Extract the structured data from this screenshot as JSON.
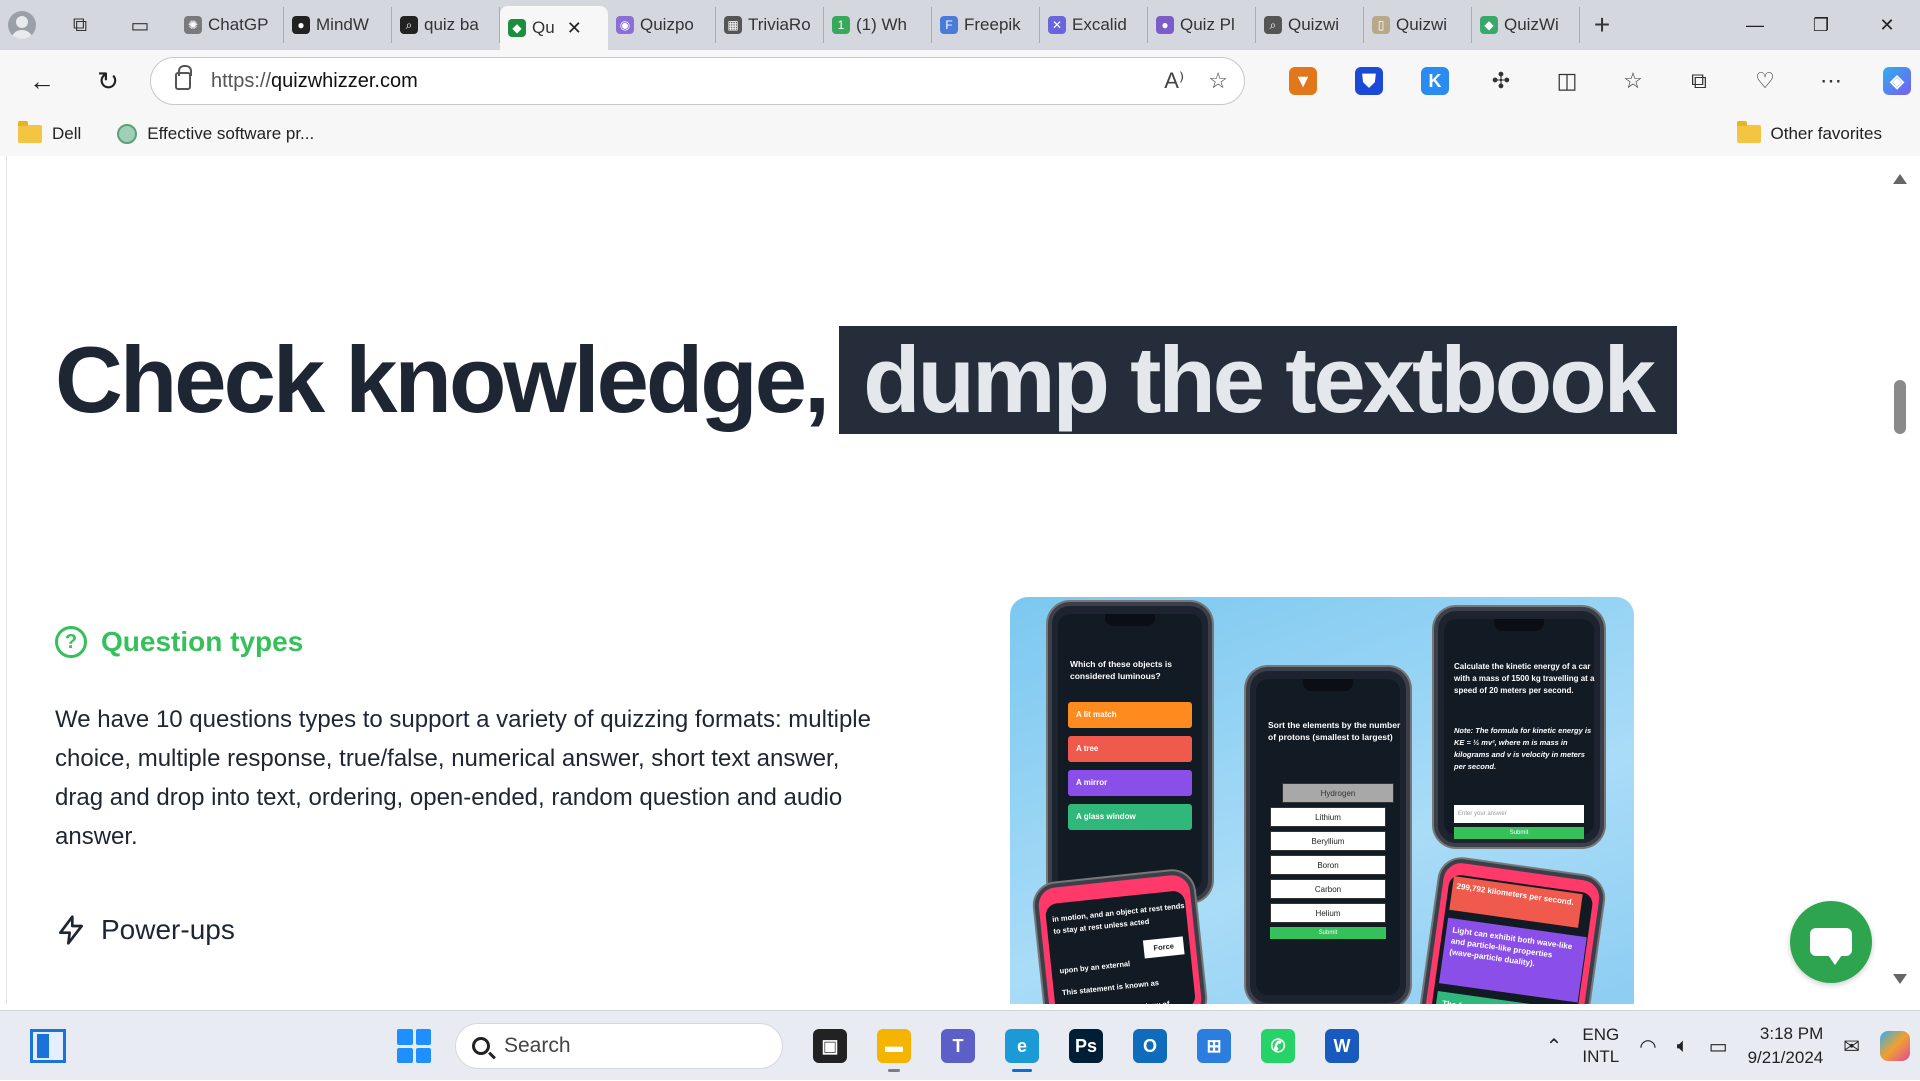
{
  "browser": {
    "tabs": [
      {
        "label": "ChatGP",
        "color": "#7a7a7a",
        "glyph": "✺"
      },
      {
        "label": "MindW",
        "color": "#222222",
        "glyph": "●"
      },
      {
        "label": "quiz ba",
        "color": "#222222",
        "glyph": "⌕"
      },
      {
        "label": "Qu",
        "color": "#1b8f3e",
        "glyph": "◆",
        "active": true
      },
      {
        "label": "Quizpo",
        "color": "#8b6fd6",
        "glyph": "◉"
      },
      {
        "label": "TriviaRo",
        "color": "#555555",
        "glyph": "▦"
      },
      {
        "label": "(1) Wh",
        "color": "#3aa85a",
        "glyph": "1"
      },
      {
        "label": "Freepik",
        "color": "#4a7bd8",
        "glyph": "F"
      },
      {
        "label": "Excalid",
        "color": "#6965db",
        "glyph": "✕"
      },
      {
        "label": "Quiz Pl",
        "color": "#7b5cc9",
        "glyph": "●"
      },
      {
        "label": "Quizwi",
        "color": "#555555",
        "glyph": "⌕"
      },
      {
        "label": "Quizwi",
        "color": "#b8a88a",
        "glyph": "▯"
      },
      {
        "label": "QuizWi",
        "color": "#39a86b",
        "glyph": "◆"
      }
    ],
    "url_prefix": "https://",
    "url_domain": "quizwhizzer.com",
    "read_aloud_icon": "A⁾",
    "favorites": [
      {
        "label": "Dell",
        "icon": "folder-icon"
      },
      {
        "label": "Effective software pr...",
        "icon": "chatgpt-icon"
      }
    ],
    "other_favorites": "Other favorites",
    "extensions": [
      {
        "name": "metamask-icon",
        "color": "#e2761b",
        "glyph": "🦊"
      },
      {
        "name": "shield-icon",
        "color": "#1a4ad6",
        "glyph": "⛊"
      },
      {
        "name": "k-extension-icon",
        "color": "#2a8cf0",
        "glyph": "K"
      }
    ]
  },
  "page": {
    "hero_plain": "Check knowledge,",
    "hero_highlight": "dump the textbook",
    "feature_title": "Question types",
    "feature_desc": "We have 10 questions types to support a variety of quizzing formats: multiple choice, multiple response, true/false, numerical answer, short text answer, drag and drop into text, ordering, open-ended, random question and audio answer.",
    "power_title": "Power-ups",
    "accent_color": "#35c05a"
  },
  "phones": {
    "p1_question": "Which of these objects is considered luminous?",
    "p1_options": [
      {
        "text": "A lit match",
        "color": "#ff8a1d"
      },
      {
        "text": "A tree",
        "color": "#ef5a4c"
      },
      {
        "text": "A mirror",
        "color": "#8a4fe8"
      },
      {
        "text": "A glass window",
        "color": "#2fb87a"
      }
    ],
    "p2_question": "Sort the elements by the number of protons (smallest to largest)",
    "p2_items": [
      "Hydrogen",
      "Lithium",
      "Beryllium",
      "Boron",
      "Carbon",
      "Helium"
    ],
    "p2_submit": "Submit",
    "p3_question": "Calculate the kinetic energy of a car with a mass of 1500 kg travelling at a speed of 20 meters per second.",
    "p3_note": "Note: The formula for kinetic energy is KE = ½ mv², where m is mass in kilograms and v is velocity in meters per second.",
    "p3_placeholder": "Enter your answer",
    "p3_submit": "Submit",
    "p4_text_a": "in motion, and an object at rest tends to stay at rest unless acted",
    "p4_force": "Force",
    "p4_text_b": "upon by an external",
    "p4_text_c": "This statement is known as",
    "p4_text_d": "Law of",
    "p5_top": "299,792 kilometers per second.",
    "p5_mid": "Light can exhibit both wave-like and particle-like properties (wave-particle duality).",
    "p5_bot": "The frequency of light"
  },
  "taskbar": {
    "search_placeholder": "Search",
    "apps": [
      {
        "name": "task-view-icon",
        "color": "#222222",
        "glyph": "▣"
      },
      {
        "name": "file-explorer-icon",
        "color": "#f4b400",
        "glyph": "▬"
      },
      {
        "name": "teams-icon",
        "color": "#5b5fc7",
        "glyph": "T"
      },
      {
        "name": "edge-icon",
        "color": "#1c9ad6",
        "glyph": "e",
        "active": true
      },
      {
        "name": "photoshop-icon",
        "color": "#001e36",
        "glyph": "Ps"
      },
      {
        "name": "outlook-icon",
        "color": "#0f6cbd",
        "glyph": "O"
      },
      {
        "name": "store-icon",
        "color": "#2b7de0",
        "glyph": "⊞"
      },
      {
        "name": "whatsapp-icon",
        "color": "#25d366",
        "glyph": "✆"
      },
      {
        "name": "word-icon",
        "color": "#185abd",
        "glyph": "W"
      }
    ],
    "lang_top": "ENG",
    "lang_bottom": "INTL",
    "time": "3:18 PM",
    "date": "9/21/2024"
  }
}
